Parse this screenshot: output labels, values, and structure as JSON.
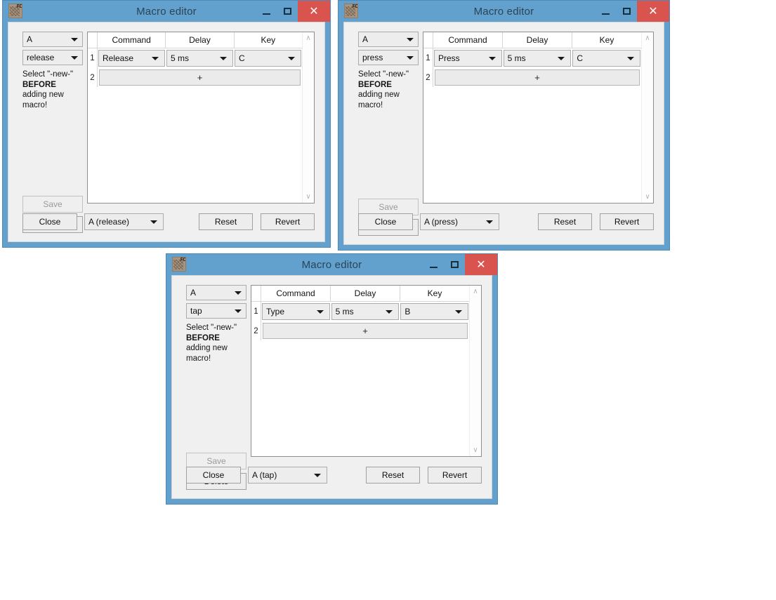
{
  "app": {
    "title": "Macro editor",
    "icon_label": "FC",
    "window_controls": {
      "minimize": "–",
      "maximize": "□",
      "close": "✕"
    },
    "accent_title_bar": "#62a0cd",
    "accent_close": "#d9544e",
    "client_bg": "#f0f0f0"
  },
  "labels": {
    "hint_line1": "Select \"-new-\"",
    "hint_line2": "BEFORE",
    "hint_line3": "adding new",
    "hint_line4": "macro!",
    "save": "Save",
    "delete": "Delete",
    "close": "Close",
    "reset": "Reset",
    "revert": "Revert",
    "add_row": "+",
    "scroll_up": "∧",
    "scroll_down": "∨"
  },
  "table": {
    "columns": [
      "Command",
      "Delay",
      "Key"
    ],
    "row_numbers": [
      "1",
      "2"
    ]
  },
  "windows": [
    {
      "id": "window-release",
      "title": "Macro editor",
      "key_combo": "A",
      "event_combo": "release",
      "rows": [
        {
          "index": "1",
          "command": "Release",
          "delay": "5 ms",
          "key": "C"
        }
      ],
      "macro_select": "A (release)"
    },
    {
      "id": "window-press",
      "title": "Macro editor",
      "key_combo": "A",
      "event_combo": "press",
      "rows": [
        {
          "index": "1",
          "command": "Press",
          "delay": "5 ms",
          "key": "C"
        }
      ],
      "macro_select": "A (press)"
    },
    {
      "id": "window-tap",
      "title": "Macro editor",
      "key_combo": "A",
      "event_combo": "tap",
      "rows": [
        {
          "index": "1",
          "command": "Type",
          "delay": "5 ms",
          "key": "B"
        }
      ],
      "macro_select": "A (tap)"
    }
  ]
}
